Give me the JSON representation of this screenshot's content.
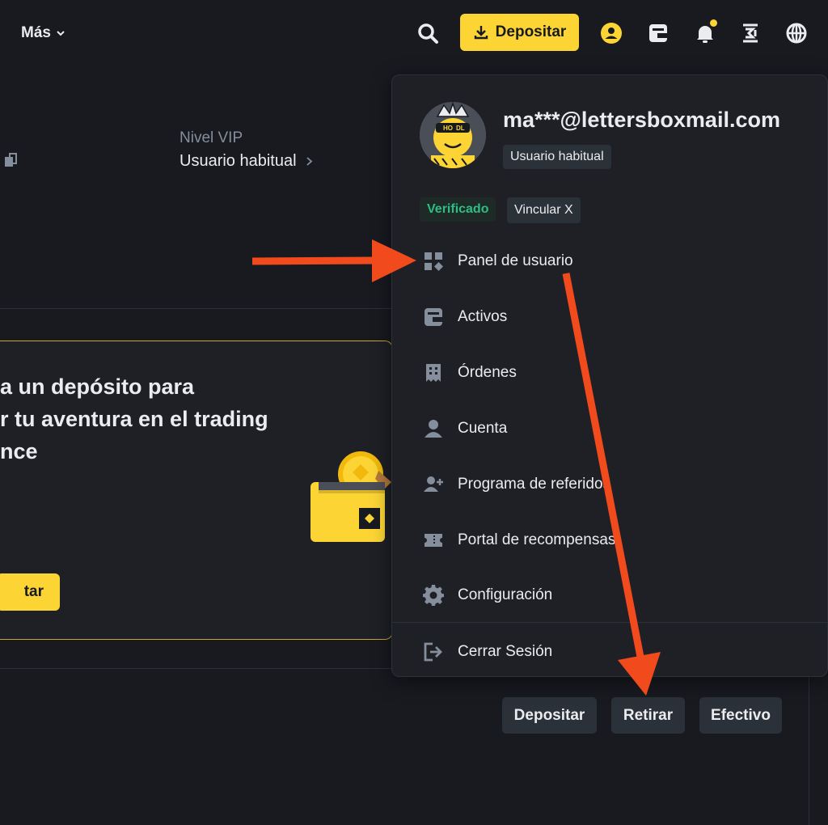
{
  "nav": {
    "more_label": "Más",
    "deposit_label": "Depositar",
    "accent_color": "#fcd535"
  },
  "profile_summary": {
    "vip_label": "Nivel VIP",
    "vip_value": "Usuario habitual"
  },
  "promo": {
    "title_lines": [
      "a un depósito para",
      "r tu aventura en el trading",
      "nce"
    ],
    "button_label": "tar"
  },
  "account_actions": {
    "deposit": "Depositar",
    "withdraw": "Retirar",
    "cash": "Efectivo"
  },
  "dropdown": {
    "email": "ma***@lettersboxmail.com",
    "user_type": "Usuario habitual",
    "verified_label": "Verificado",
    "link_x_label": "Vincular X",
    "avatar_text": "HODL",
    "items": [
      {
        "label": "Panel de usuario",
        "icon": "dashboard-icon"
      },
      {
        "label": "Activos",
        "icon": "wallet-icon"
      },
      {
        "label": "Órdenes",
        "icon": "orders-icon"
      },
      {
        "label": "Cuenta",
        "icon": "user-icon"
      },
      {
        "label": "Programa de referidos",
        "icon": "add-user-icon"
      },
      {
        "label": "Portal de recompensas",
        "icon": "ticket-icon"
      },
      {
        "label": "Configuración",
        "icon": "gear-icon"
      },
      {
        "label": "Cerrar Sesión",
        "icon": "logout-icon"
      }
    ]
  },
  "colors": {
    "background": "#181a20",
    "panel": "#1e2026",
    "verified_green": "#2ebd85",
    "annotation_arrow": "#f04a1d"
  }
}
